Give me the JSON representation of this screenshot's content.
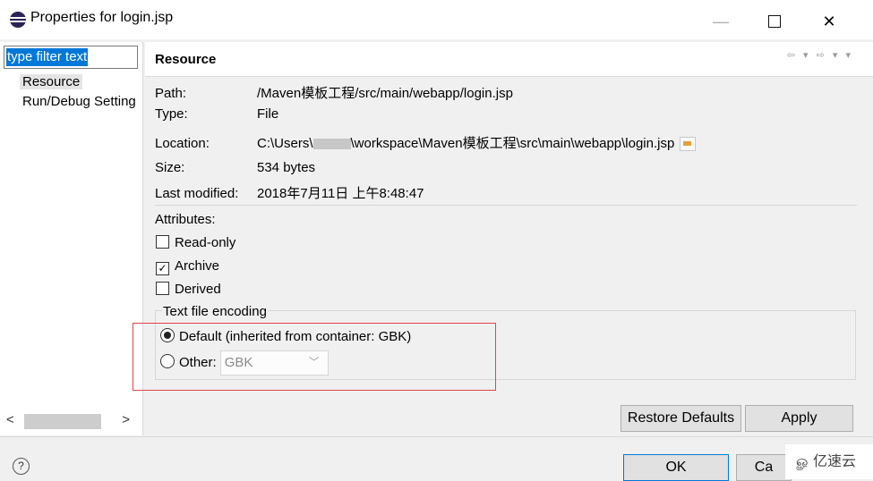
{
  "window": {
    "title": "Properties for login.jsp",
    "minimize_glyph": "—",
    "close_glyph": "✕"
  },
  "sidebar": {
    "filter_text": "type filter text",
    "items": [
      {
        "label": "Resource"
      },
      {
        "label": "Run/Debug Settings"
      }
    ],
    "scroll_left": "<",
    "scroll_right": ">"
  },
  "page": {
    "title": "Resource",
    "nav_arrows": "⇦ ▾ ⇨ ▾ ▾",
    "properties": {
      "path_label": "Path:",
      "path_value": "/Maven模板工程/src/main/webapp/login.jsp",
      "type_label": "Type:",
      "type_value": "File",
      "location_label": "Location:",
      "location_prefix": "C:\\Users\\",
      "location_suffix": "\\workspace\\Maven模板工程\\src\\main\\webapp\\login.jsp",
      "size_label": "Size:",
      "size_value": "534  bytes",
      "modified_label": "Last modified:",
      "modified_value": "2018年7月11日 上午8:48:47"
    },
    "attributes": {
      "heading": "Attributes:",
      "read_only": {
        "label": "Read-only",
        "checked": false
      },
      "archive": {
        "label": "Archive",
        "checked": true,
        "check_glyph": "✓"
      },
      "derived": {
        "label": "Derived",
        "checked": false
      }
    },
    "encoding": {
      "group_label": "Text file encoding",
      "default_label": "Default (inherited from container: GBK)",
      "default_selected": true,
      "other_label": "Other:",
      "other_value": "GBK",
      "chevron": "﹀"
    }
  },
  "buttons": {
    "restore_defaults": "Restore Defaults",
    "apply": "Apply",
    "ok": "OK",
    "cancel": "Ca",
    "help": "?"
  },
  "watermark": {
    "icon": "ௐ",
    "text": "亿速云"
  },
  "colors": {
    "selection": "#0078d7",
    "highlight_box": "#e04646",
    "app_icon": "#2c2255"
  }
}
